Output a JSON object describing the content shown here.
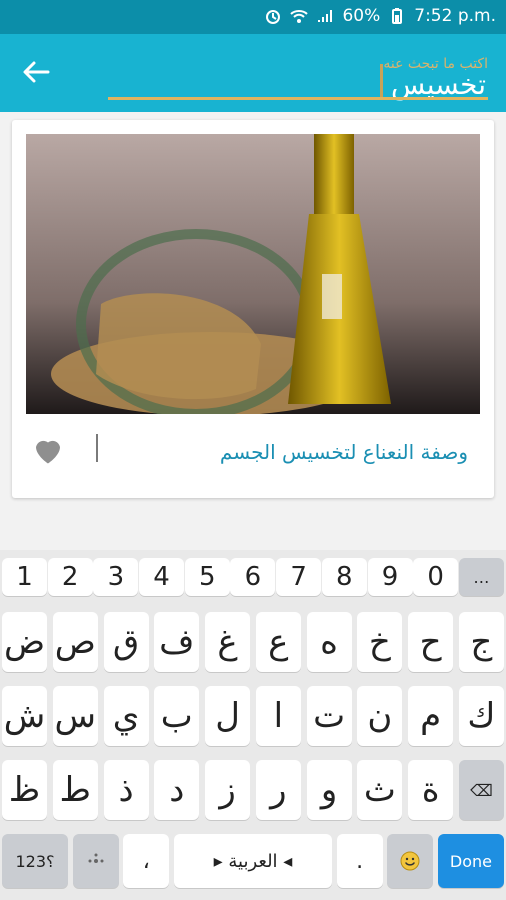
{
  "status_bar": {
    "battery_text": "60%",
    "time": "7:52 p.m."
  },
  "app_bar": {
    "search_hint": "اكتب ما تبحث عنه",
    "search_value": "تخسيس"
  },
  "card": {
    "title": "وصفة النعناع لتخسيس الجسم"
  },
  "keyboard": {
    "row_numbers": [
      "1",
      "2",
      "3",
      "4",
      "5",
      "6",
      "7",
      "8",
      "9",
      "0",
      "…"
    ],
    "row_letters_1": [
      "ض",
      "ص",
      "ق",
      "ف",
      "غ",
      "ع",
      "ه",
      "خ",
      "ح",
      "ج"
    ],
    "row_letters_2": [
      "ش",
      "س",
      "ي",
      "ب",
      "ل",
      "ا",
      "ت",
      "ن",
      "م",
      "ك"
    ],
    "row_letters_3": [
      "ظ",
      "ط",
      "ذ",
      "د",
      "ز",
      "ر",
      "و",
      "ث",
      "ة",
      "⌫"
    ],
    "bottom": {
      "symbols": "123؟",
      "comma": "،",
      "space_label": "◂ العربية ▸",
      "dot": ".",
      "done": "Done"
    }
  }
}
